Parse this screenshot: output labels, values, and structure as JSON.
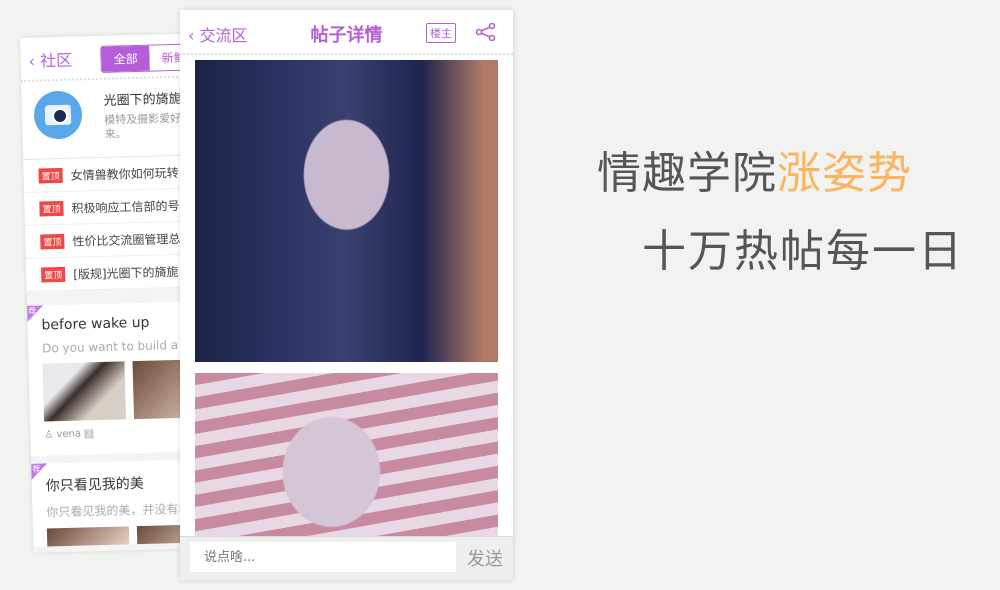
{
  "back_screen": {
    "back_label": "社区",
    "tabs": [
      "全部",
      "新鲜"
    ],
    "group": {
      "title": "光圈下的旖旎",
      "desc": "模特及摄影爱好者都来。"
    },
    "pinned_tag": "置顶",
    "pinned": [
      "女情兽教你如何玩转",
      "积极响应工信部的号召",
      "性价比交流圈管理总则",
      "[版规]光圈下的旖旎"
    ],
    "rec_tag": "荐",
    "posts": [
      {
        "title": "before wake up",
        "desc": "Do you want to build a snowman",
        "user": "vena",
        "count": "3"
      },
      {
        "title": "你只看见我的美",
        "desc": "你只看见我的美，并没有看见"
      }
    ]
  },
  "front_screen": {
    "back_label": "交流区",
    "title": "帖子详情",
    "owner_badge": "楼主",
    "input_placeholder": "说点啥...",
    "send_label": "发送"
  },
  "slogan": {
    "line1_a": "情趣学院",
    "line1_b": "涨姿势",
    "line2": "十万热帖每一日"
  },
  "colors": {
    "accent": "#b45fd9",
    "highlight": "#fbb55e",
    "pin": "#f04848"
  }
}
